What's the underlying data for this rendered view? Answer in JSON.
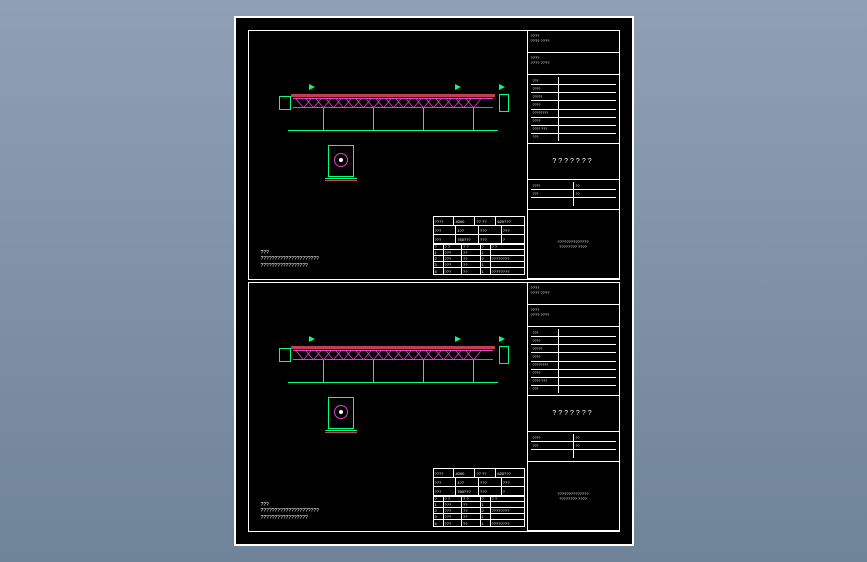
{
  "sheets": [
    {
      "header": {
        "line1": "????",
        "line2": "???? ????"
      },
      "sub": {
        "line1": "????",
        "line2": "???? ????"
      },
      "fields": [
        {
          "label": "???",
          "value": ""
        },
        {
          "label": "????",
          "value": ""
        },
        {
          "label": "?????",
          "value": ""
        },
        {
          "label": "????",
          "value": ""
        },
        {
          "label": "????????",
          "value": ""
        },
        {
          "label": "????",
          "value": ""
        },
        {
          "label": "???? ???",
          "value": ""
        },
        {
          "label": "???",
          "value": ""
        }
      ],
      "title": "???????",
      "meta": {
        "rows": [
          [
            "????",
            "??"
          ],
          [
            "???",
            "??"
          ],
          [
            "",
            ""
          ]
        ]
      },
      "footer": {
        "line1": "??????????????",
        "line2": "???????? ????"
      },
      "param_table": {
        "rows": [
          [
            "????",
            "4000",
            "?? ??",
            "620???"
          ],
          [
            "???",
            "1??",
            "???",
            "???"
          ],
          [
            "???",
            "760???",
            "???",
            "?"
          ]
        ]
      },
      "bottom_table": {
        "rows": [
          [
            "?",
            "? ?",
            "? ?",
            "?",
            "?   ?"
          ],
          [
            "1",
            "???",
            "??",
            "1",
            ""
          ],
          [
            "2",
            "???",
            "??",
            "2",
            "????????"
          ],
          [
            "3",
            "???",
            "??",
            "1",
            ""
          ],
          [
            "4",
            "???",
            "??",
            "1",
            "????????"
          ]
        ]
      },
      "notes": {
        "heading": "???",
        "line1": "?????????????????????",
        "line2": "?????????????????"
      }
    },
    {
      "header": {
        "line1": "????",
        "line2": "???? ????"
      },
      "sub": {
        "line1": "????",
        "line2": "???? ????"
      },
      "fields": [
        {
          "label": "???",
          "value": ""
        },
        {
          "label": "????",
          "value": ""
        },
        {
          "label": "?????",
          "value": ""
        },
        {
          "label": "????",
          "value": ""
        },
        {
          "label": "????????",
          "value": ""
        },
        {
          "label": "????",
          "value": ""
        },
        {
          "label": "???? ???",
          "value": ""
        },
        {
          "label": "???",
          "value": ""
        }
      ],
      "title": "???????",
      "meta": {
        "rows": [
          [
            "????",
            "??"
          ],
          [
            "???",
            "??"
          ],
          [
            "",
            ""
          ]
        ]
      },
      "footer": {
        "line1": "??????????????",
        "line2": "???????? ????"
      },
      "param_table": {
        "rows": [
          [
            "????",
            "4000",
            "?? ??",
            "620???"
          ],
          [
            "???",
            "1??",
            "???",
            "???"
          ],
          [
            "???",
            "760???",
            "???",
            "?"
          ]
        ]
      },
      "bottom_table": {
        "rows": [
          [
            "?",
            "? ?",
            "? ?",
            "?",
            "?   ?"
          ],
          [
            "1",
            "???",
            "??",
            "1",
            ""
          ],
          [
            "2",
            "???",
            "??",
            "2",
            "????????"
          ],
          [
            "3",
            "???",
            "??",
            "1",
            ""
          ],
          [
            "4",
            "???",
            "??",
            "1",
            "????????"
          ]
        ]
      },
      "notes": {
        "heading": "???",
        "line1": "?????????????????????",
        "line2": "?????????????????"
      }
    }
  ]
}
